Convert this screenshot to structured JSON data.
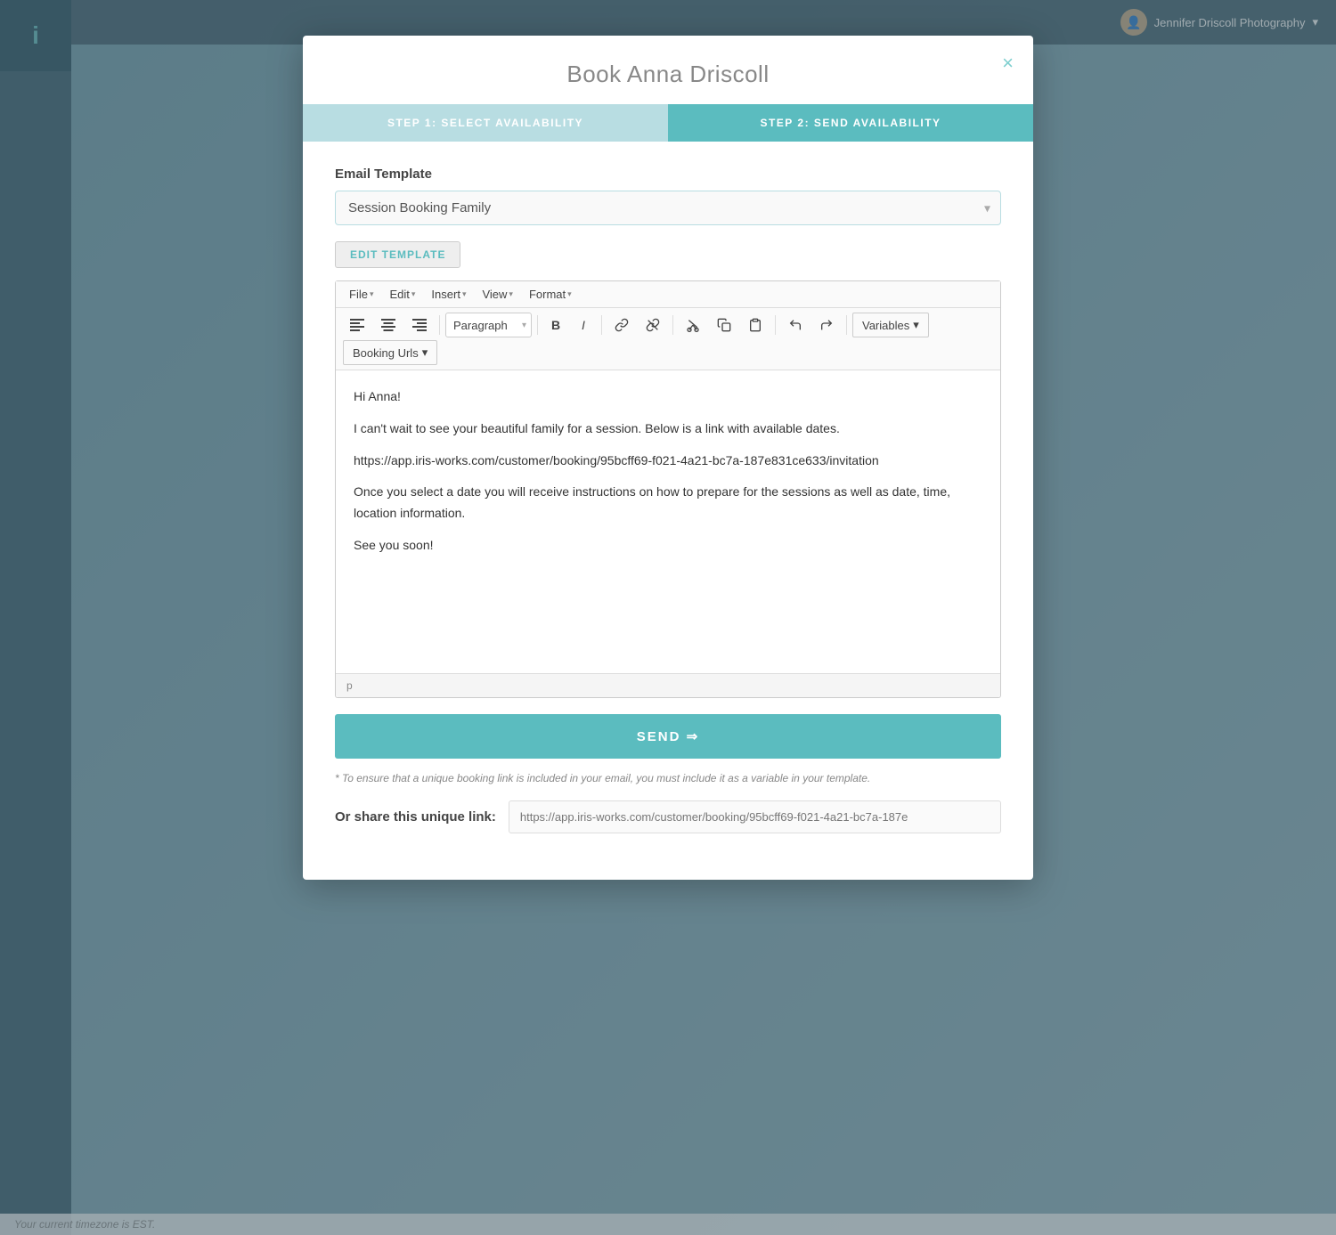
{
  "app": {
    "user": "Jennifer Driscoll Photography",
    "timezone_note": "Your current timezone is EST."
  },
  "modal": {
    "title": "Book Anna Driscoll",
    "close_label": "×",
    "steps": [
      {
        "label": "STEP 1: SELECT AVAILABILITY",
        "state": "inactive"
      },
      {
        "label": "STEP 2: SEND AVAILABILITY",
        "state": "active"
      }
    ],
    "email_template_section": {
      "label": "Email Template",
      "selected_value": "Session Booking Family",
      "edit_button_label": "EDIT TEMPLATE"
    },
    "editor": {
      "menubar": {
        "items": [
          {
            "label": "File",
            "has_arrow": true
          },
          {
            "label": "Edit",
            "has_arrow": true
          },
          {
            "label": "Insert",
            "has_arrow": true
          },
          {
            "label": "View",
            "has_arrow": true
          },
          {
            "label": "Format",
            "has_arrow": true
          }
        ]
      },
      "toolbar": {
        "align_left": "≡",
        "align_center": "≡",
        "align_right": "≡",
        "paragraph_option": "Paragraph",
        "bold": "B",
        "italic": "I",
        "link": "🔗",
        "unlink": "🔗",
        "cut": "✂",
        "copy": "⧉",
        "paste": "📋",
        "undo": "↩",
        "redo": "↪",
        "variables_label": "Variables",
        "booking_urls_label": "Booking Urls"
      },
      "content": {
        "greeting": "Hi Anna!",
        "body1": "I can't wait to see your beautiful family for a session.  Below is a link with available dates.",
        "booking_link": "https://app.iris-works.com/customer/booking/95bcff69-f021-4a21-bc7a-187e831ce633/invitation",
        "body2": "Once you select a date you will receive instructions on how to prepare for the sessions as well as date, time, location information.",
        "closing": "See you soon!"
      },
      "footer_tag": "p"
    },
    "send_button_label": "SEND ⇒",
    "warning_text": "* To ensure that a unique booking link is included in your email, you must include it as a variable in your template.",
    "share_link": {
      "label": "Or share this unique link:",
      "value": "https://app.iris-works.com/customer/booking/95bcff69-f021-4a21-bc7a-187e"
    }
  }
}
